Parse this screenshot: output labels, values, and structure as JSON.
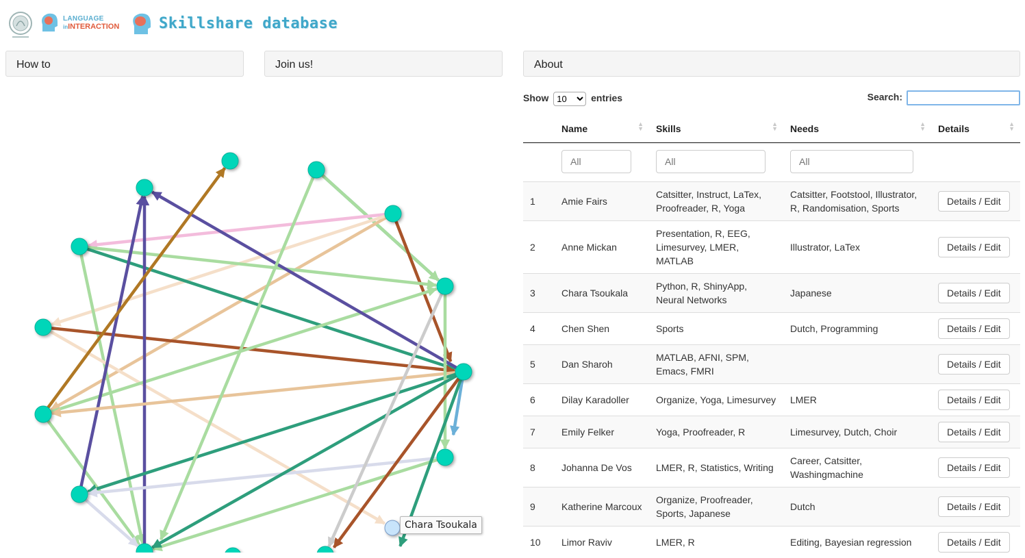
{
  "header": {
    "logo_lii_line1": "LANGUAGE",
    "logo_lii_in": "in",
    "logo_lii_line2": "INTERACTION",
    "app_title": "Skillshare database"
  },
  "panels": {
    "howto": "How to",
    "joinus": "Join us!",
    "about": "About"
  },
  "graph": {
    "tooltip": "Chara Tsoukala",
    "node_color": "#00d6b9",
    "highlight_node_color": "#c8e4fb",
    "edge_colors": [
      "#2e9e7c",
      "#a9dca0",
      "#5a4fa0",
      "#a8542a",
      "#f3bcdc",
      "#e8c49a",
      "#f5dfc9",
      "#b07824",
      "#d8dbeb",
      "#cccccc",
      "#6bb0d8"
    ]
  },
  "table": {
    "show_label": "Show",
    "entries_label": "entries",
    "page_length": "10",
    "search_label": "Search:",
    "columns": [
      "Name",
      "Skills",
      "Needs",
      "Details"
    ],
    "filter_placeholder": "All",
    "details_button": "Details / Edit",
    "rows": [
      {
        "num": "1",
        "name": "Amie Fairs",
        "skills": "Catsitter, Instruct, LaTex, Proofreader, R, Yoga",
        "needs": "Catsitter, Footstool, Illustrator, R, Randomisation, Sports"
      },
      {
        "num": "2",
        "name": "Anne Mickan",
        "skills": "Presentation, R, EEG, Limesurvey, LMER, MATLAB",
        "needs": "Illustrator, LaTex"
      },
      {
        "num": "3",
        "name": "Chara Tsoukala",
        "skills": "Python, R, ShinyApp, Neural Networks",
        "needs": "Japanese"
      },
      {
        "num": "4",
        "name": "Chen Shen",
        "skills": "Sports",
        "needs": "Dutch, Programming"
      },
      {
        "num": "5",
        "name": "Dan Sharoh",
        "skills": "MATLAB, AFNI, SPM, Emacs, FMRI",
        "needs": ""
      },
      {
        "num": "6",
        "name": "Dilay Karadoller",
        "skills": "Organize, Yoga, Limesurvey",
        "needs": "LMER"
      },
      {
        "num": "7",
        "name": "Emily Felker",
        "skills": "Yoga, Proofreader, R",
        "needs": "Limesurvey, Dutch, Choir"
      },
      {
        "num": "8",
        "name": "Johanna De Vos",
        "skills": "LMER, R, Statistics, Writing",
        "needs": "Career, Catsitter, Washingmachine"
      },
      {
        "num": "9",
        "name": "Katherine Marcoux",
        "skills": "Organize, Proofreader, Sports, Japanese",
        "needs": "Dutch"
      },
      {
        "num": "10",
        "name": "Limor Raviv",
        "skills": "LMER, R",
        "needs": "Editing, Bayesian regression"
      }
    ]
  }
}
